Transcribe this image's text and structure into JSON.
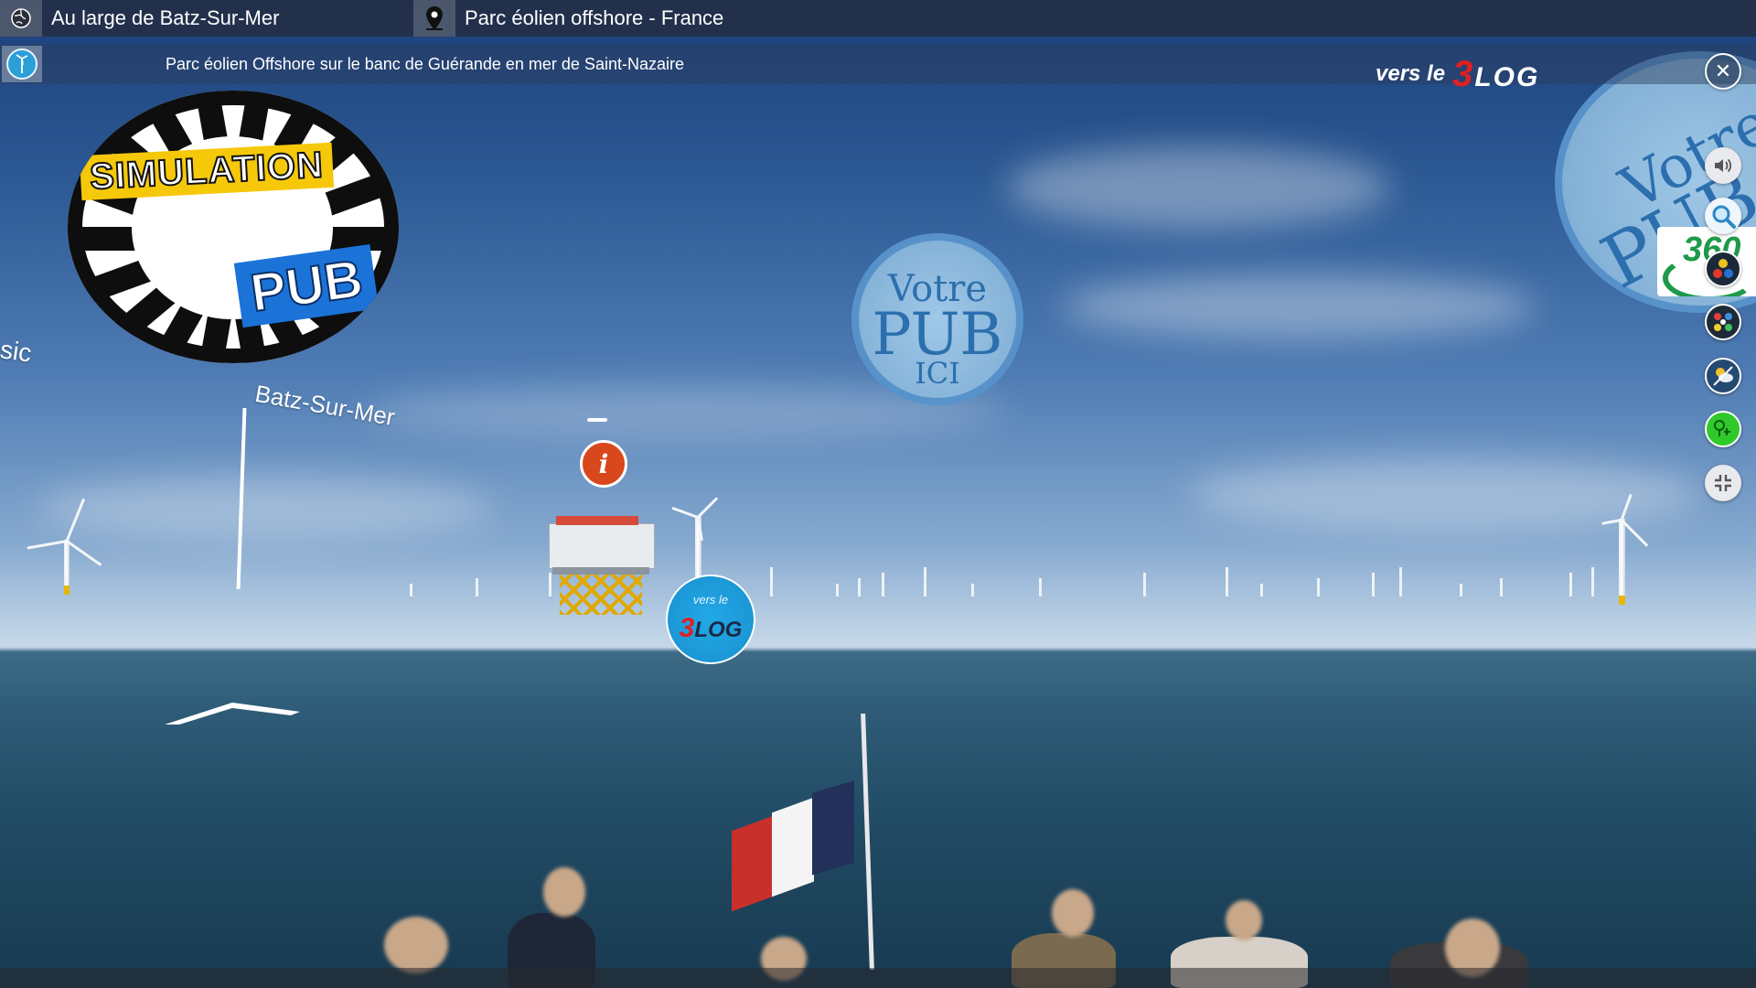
{
  "header": {
    "location_title": "Au large de Batz-Sur-Mer",
    "place_title": "Parc éolien offshore - France",
    "subtitle": "Parc éolien Offshore sur le banc de Guérande en mer de Saint-Nazaire"
  },
  "blog_banner": {
    "prefix": "vers le",
    "logo_number": "3",
    "logo_text": "LOG"
  },
  "overlays": {
    "simulation_label": "SIMULATION",
    "pub_label": "PUB",
    "votre_pub": {
      "line1": "Votre",
      "line2": "PUB",
      "line3": "ICI"
    },
    "panorama_badge_number": "360",
    "info_icon_glyph": "i",
    "blog_hotspot": {
      "prefix": "vers le",
      "logo_number": "3",
      "logo_text": "LOG"
    }
  },
  "scene_labels": {
    "batz": "Batz-Sur-Mer",
    "music": "isic"
  },
  "toolbar": {
    "close_glyph": "✕",
    "items": [
      "close-icon",
      "speaker-icon",
      "magnifier-icon",
      "controller-icon",
      "dice-icon",
      "weather-icon",
      "share-icon",
      "exit-fullscreen-icon"
    ]
  },
  "colors": {
    "title_bar": "#232d46",
    "info_hotspot": "#d9471c",
    "blog_hotspot": "#22a9e6",
    "simulation_yellow": "#f5c80a",
    "pub_blue": "#1b73d8",
    "share_green": "#2fc92a"
  }
}
